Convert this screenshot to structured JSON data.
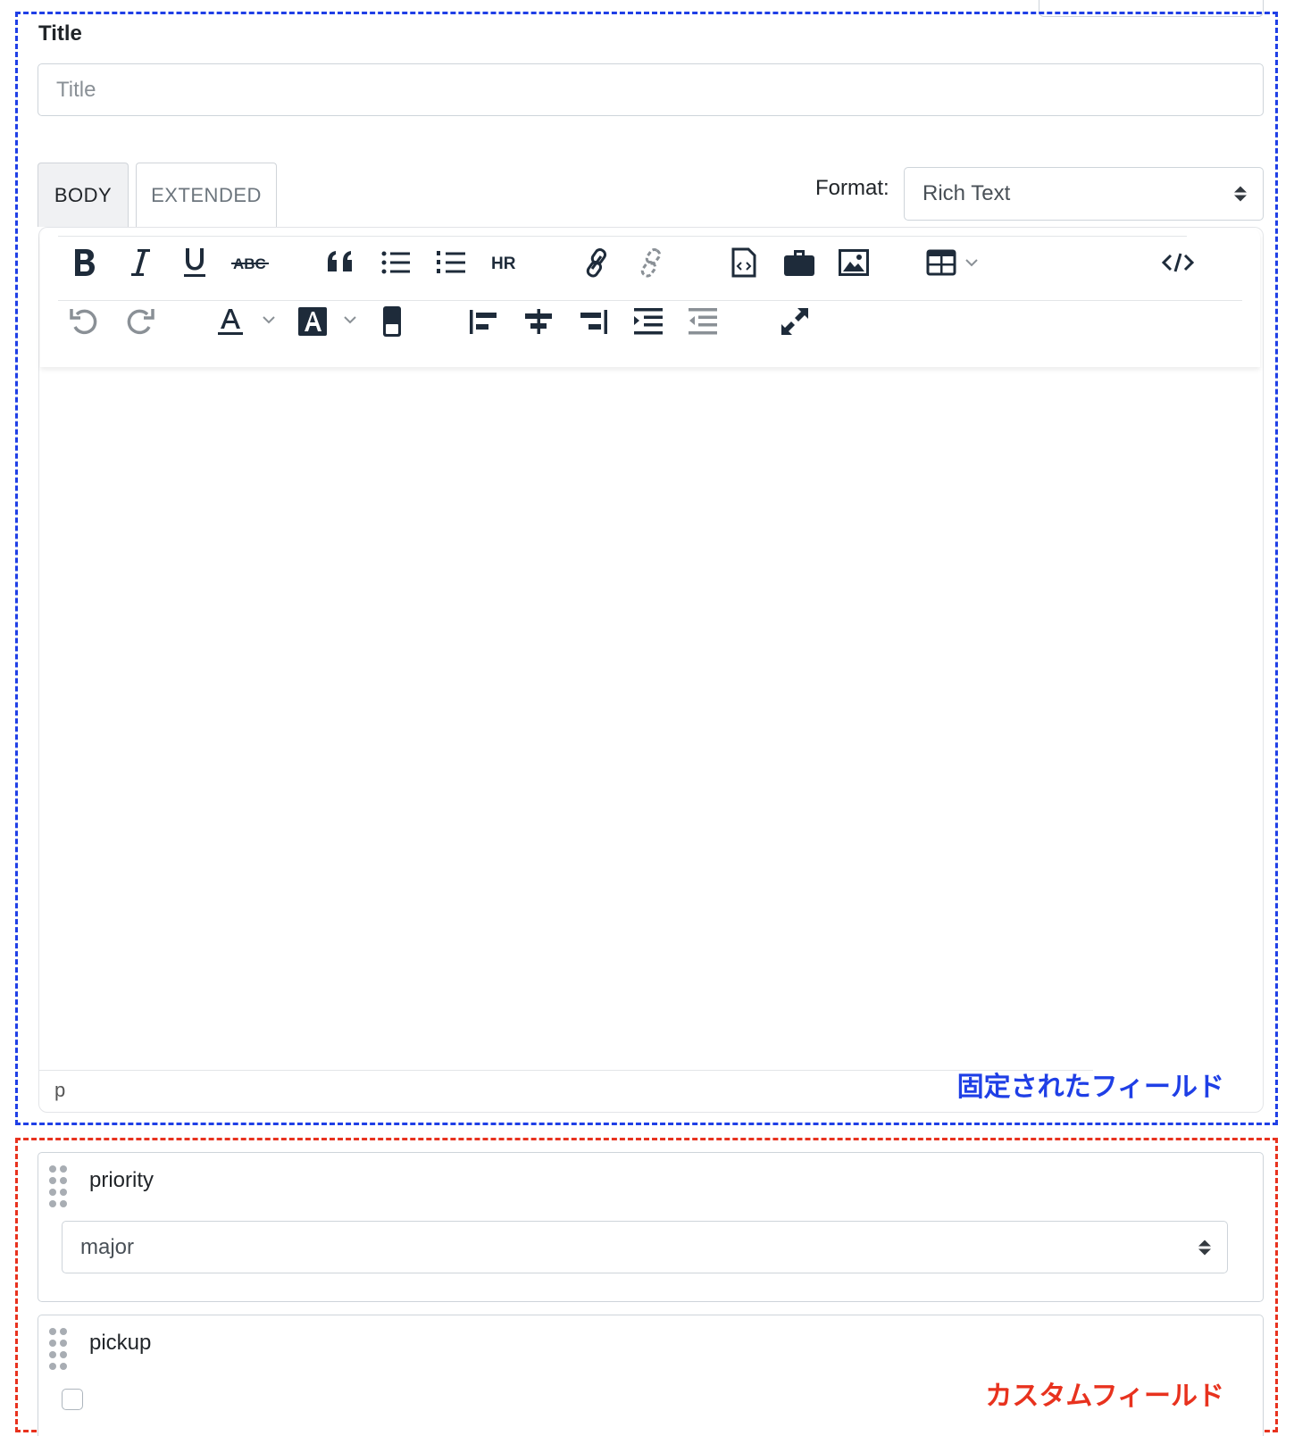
{
  "title_field": {
    "label": "Title",
    "placeholder": "Title"
  },
  "tabs": [
    {
      "label": "BODY",
      "active": true
    },
    {
      "label": "EXTENDED",
      "active": false
    }
  ],
  "format": {
    "label": "Format:",
    "value": "Rich Text"
  },
  "toolbar": {
    "row1": [
      "bold-icon",
      "italic-icon",
      "underline-icon",
      "strikethrough-icon",
      "blockquote-icon",
      "bullet-list-icon",
      "numbered-list-icon",
      "horizontal-rule-icon",
      "link-icon",
      "unlink-icon",
      "code-file-icon",
      "briefcase-icon",
      "image-icon",
      "table-icon",
      "source-code-icon"
    ],
    "row2": [
      "undo-icon",
      "redo-icon",
      "text-color-icon",
      "background-color-icon",
      "highlight-icon",
      "align-left-icon",
      "align-center-icon",
      "align-right-icon",
      "indent-icon",
      "outdent-icon",
      "fullscreen-icon"
    ],
    "hr_label": "HR",
    "abc_label": "ABC"
  },
  "editor": {
    "status_path": "p"
  },
  "annotations": {
    "fixed_fields": "固定されたフィールド",
    "custom_fields": "カスタムフィールド",
    "fixed_color": "#1f3fe6",
    "custom_color": "#e8321e"
  },
  "custom_fields": [
    {
      "label": "priority",
      "type": "select",
      "value": "major"
    },
    {
      "label": "pickup",
      "type": "checkbox",
      "checked": false
    }
  ],
  "colors": {
    "icon": "#1e2b3a",
    "icon_muted": "#8a9096"
  }
}
